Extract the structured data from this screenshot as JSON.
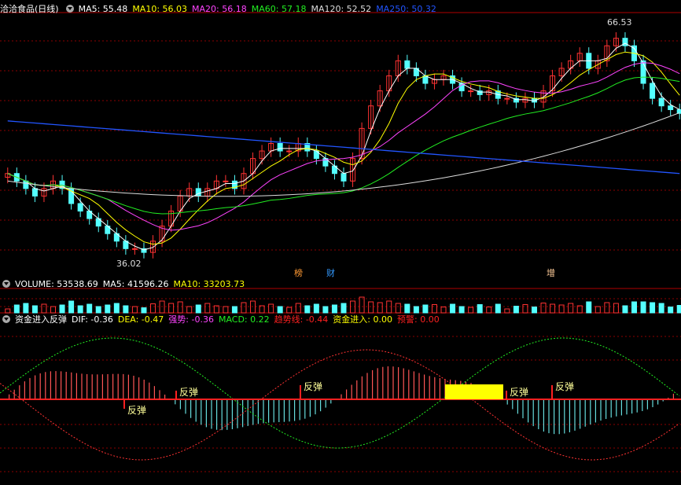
{
  "header": {
    "title": "洽洽食品(日线)",
    "ma": [
      {
        "label": "MA5: 55.48",
        "color": "#ffffff"
      },
      {
        "label": "MA10: 56.03",
        "color": "#ffff00"
      },
      {
        "label": "MA20: 56.18",
        "color": "#ff44ff"
      },
      {
        "label": "MA60: 57.18",
        "color": "#22ee22"
      },
      {
        "label": "MA120: 52.52",
        "color": "#dddddd"
      },
      {
        "label": "MA250: 50.32",
        "color": "#2255ff"
      }
    ]
  },
  "volume_header": {
    "items": [
      {
        "label": "VOLUME: 53538.69",
        "color": "#ffffff"
      },
      {
        "label": "MA5: 41596.26",
        "color": "#ffffff"
      },
      {
        "label": "MA10: 33203.73",
        "color": "#ffff00"
      }
    ]
  },
  "indicator_header": {
    "items": [
      {
        "label": "资金进入反弹",
        "color": "#ffffff"
      },
      {
        "label": "DIF: -0.36",
        "color": "#ffffff"
      },
      {
        "label": "DEA: -0.47",
        "color": "#ffff00"
      },
      {
        "label": "强势: -0.36",
        "color": "#ff44ff"
      },
      {
        "label": "MACD: 0.22",
        "color": "#22ee22"
      },
      {
        "label": "趋势线: -0.44",
        "color": "#ff2020"
      },
      {
        "label": "资金进入: 0.00",
        "color": "#ffff00"
      },
      {
        "label": "预警: 0.00",
        "color": "#ff2020"
      }
    ]
  },
  "markers": {
    "high_label": "66.53",
    "low_label": "36.02",
    "event1": "榜",
    "event2": "财",
    "event3": "增",
    "rebound": "反弹"
  },
  "colors": {
    "up": "#ff3232",
    "down": "#54ffff",
    "grid": "#8b0000"
  },
  "chart_data": {
    "type": "candlestick",
    "price_range": [
      34,
      68
    ],
    "high": 66.53,
    "low": 36.02,
    "closes": [
      47,
      46,
      45,
      44,
      45,
      46,
      45,
      43,
      42,
      41,
      40,
      39,
      38,
      37,
      37,
      36.5,
      38,
      40,
      42,
      44,
      45,
      44,
      45,
      46,
      46,
      45,
      47,
      49,
      50,
      51,
      50,
      50,
      51,
      50,
      49,
      48,
      47,
      46,
      49,
      53,
      56,
      58,
      60,
      62,
      61,
      60,
      59,
      59.5,
      60,
      59,
      58,
      58,
      57.5,
      58,
      57,
      57,
      56.5,
      57,
      56.5,
      58,
      60,
      61,
      62,
      63,
      61,
      62,
      64,
      65,
      64,
      62,
      59,
      57,
      56,
      55.5,
      55
    ]
  }
}
